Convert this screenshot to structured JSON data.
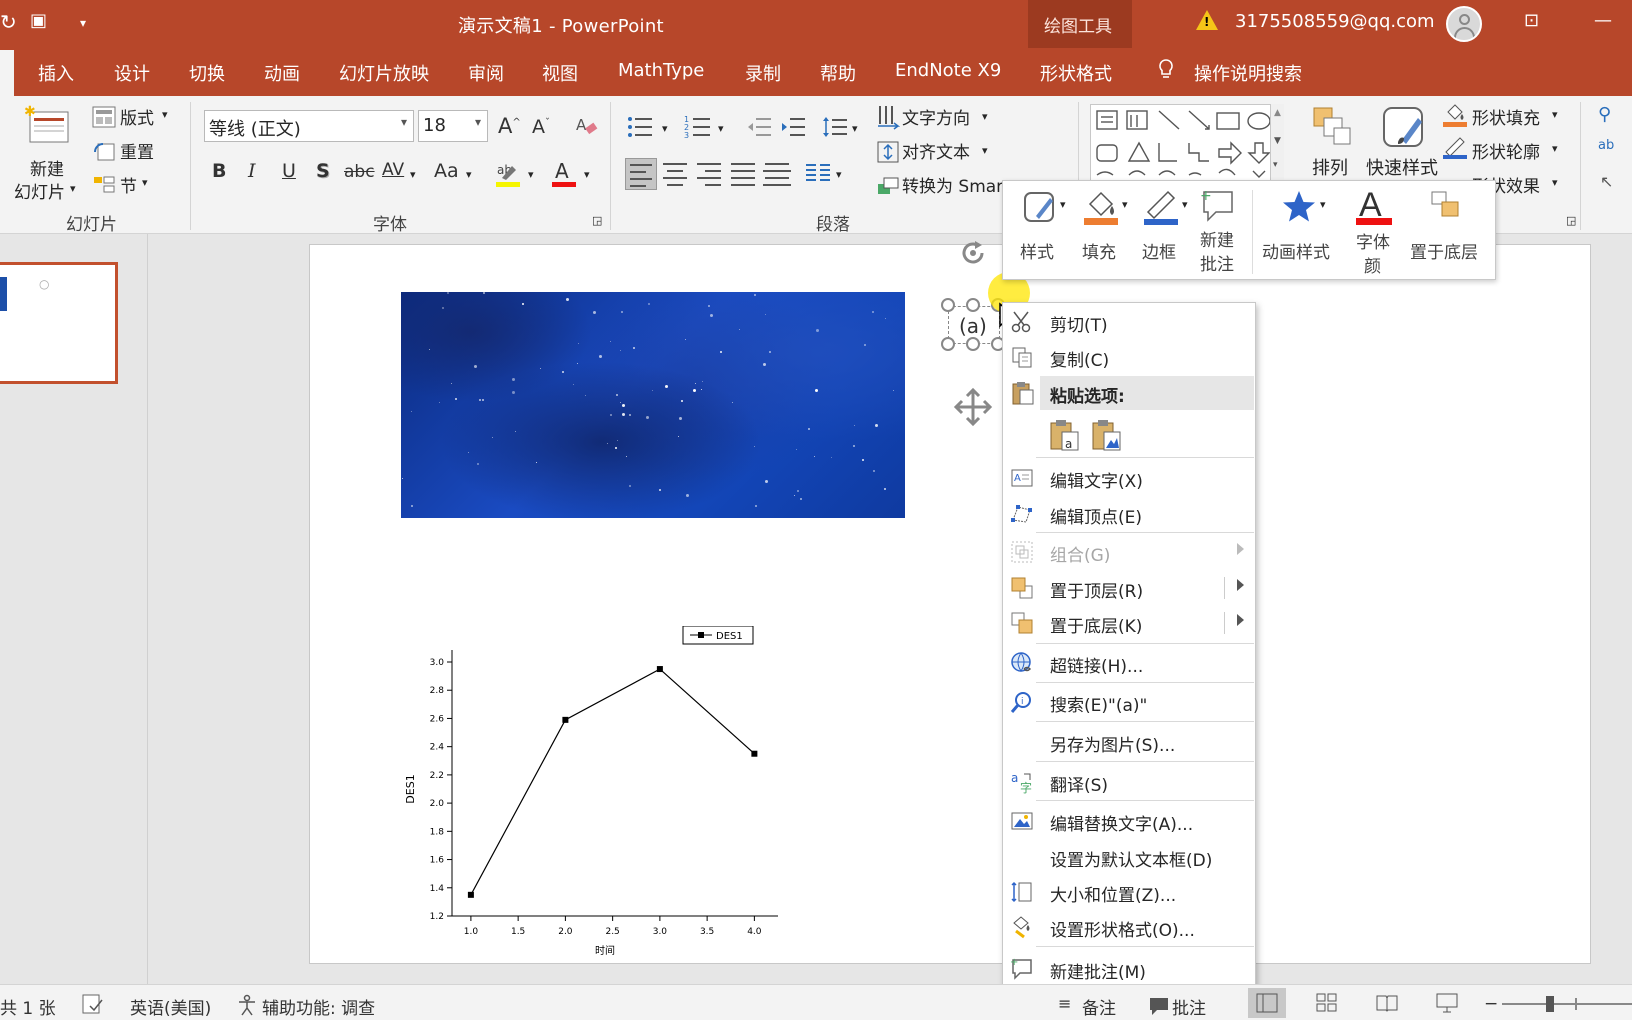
{
  "titlebar": {
    "doc_title": "演示文稿1  -  PowerPoint",
    "context_tool": "绘图工具",
    "account": "3175508559@qq.com"
  },
  "tabs": [
    "插入",
    "设计",
    "切换",
    "动画",
    "幻灯片放映",
    "审阅",
    "视图",
    "MathType",
    "录制",
    "帮助",
    "EndNote X9",
    "形状格式"
  ],
  "tell_me": "操作说明搜索",
  "ribbon": {
    "slides_group": {
      "new_slide": "新建",
      "new_slide2": "幻灯片",
      "layout": "版式",
      "reset": "重置",
      "section": "节",
      "label": "幻灯片"
    },
    "font_group": {
      "font_name": "等线 (正文)",
      "font_size": "18",
      "label": "字体",
      "bold": "B",
      "italic": "I",
      "underline": "U",
      "shadow": "S",
      "strike": "abc",
      "spacing": "AV",
      "case": "Aa"
    },
    "paragraph_group": {
      "text_direction": "文字方向",
      "align_text": "对齐文本",
      "convert_smartart": "转换为 Smar",
      "label": "段落"
    },
    "drawing_group": {
      "arrange": "排列",
      "quick_styles": "快速样式",
      "shape_fill": "形状填充",
      "shape_outline": "形状轮廓",
      "shape_effects": "形状效果"
    }
  },
  "mini_toolbar": {
    "style": "样式",
    "fill": "填充",
    "outline": "边框",
    "new_comment_1": "新建",
    "new_comment_2": "批注",
    "animation_styles": "动画样式",
    "font_color_1": "字体",
    "font_color_2": "颜",
    "send_back": "置于底层"
  },
  "slide": {
    "selected_text": "(a)"
  },
  "context_menu": {
    "items": [
      {
        "label": "剪切(T)",
        "icon": "scissors-icon"
      },
      {
        "label": "复制(C)",
        "icon": "copy-icon"
      },
      {
        "label": "粘贴选项:",
        "icon": "paste-icon"
      },
      {
        "label": "编辑文字(X)",
        "icon": "edit-text-icon"
      },
      {
        "label": "编辑顶点(E)",
        "icon": "edit-points-icon"
      },
      {
        "label": "组合(G)",
        "icon": "group-icon"
      },
      {
        "label": "置于顶层(R)",
        "icon": "bring-front-icon"
      },
      {
        "label": "置于底层(K)",
        "icon": "send-back-icon"
      },
      {
        "label": "超链接(H)...",
        "icon": "hyperlink-icon"
      },
      {
        "label": "搜索(E)\"(a)\"",
        "icon": "search-icon"
      },
      {
        "label": "另存为图片(S)...",
        "icon": ""
      },
      {
        "label": "翻译(S)",
        "icon": "translate-icon"
      },
      {
        "label": "编辑替换文字(A)...",
        "icon": "alt-text-icon"
      },
      {
        "label": "设置为默认文本框(D)",
        "icon": ""
      },
      {
        "label": "大小和位置(Z)...",
        "icon": "size-position-icon"
      },
      {
        "label": "设置形状格式(O)...",
        "icon": "format-shape-icon"
      },
      {
        "label": "新建批注(M)",
        "icon": "comment-icon"
      }
    ]
  },
  "statusbar": {
    "slide_count": "共 1 张",
    "language": "英语(美国)",
    "accessibility": "辅助功能: 调查",
    "notes": "备注",
    "comments": "批注"
  },
  "chart_data": {
    "type": "line",
    "x": [
      1.0,
      2.0,
      3.0,
      4.0
    ],
    "series": [
      {
        "name": "DES1",
        "values": [
          1.35,
          2.59,
          2.95,
          2.35
        ]
      }
    ],
    "xlabel": "时间",
    "ylabel": "DES1",
    "xlim": [
      0.8,
      4.25
    ],
    "ylim": [
      1.2,
      3.0
    ],
    "xticks": [
      "1.0",
      "1.5",
      "2.0",
      "2.5",
      "3.0",
      "3.5",
      "4.0"
    ],
    "yticks": [
      "1.2",
      "1.4",
      "1.6",
      "1.8",
      "2.0",
      "2.2",
      "2.4",
      "2.6",
      "2.8",
      "3.0"
    ],
    "legend": "top-right",
    "grid": false
  }
}
